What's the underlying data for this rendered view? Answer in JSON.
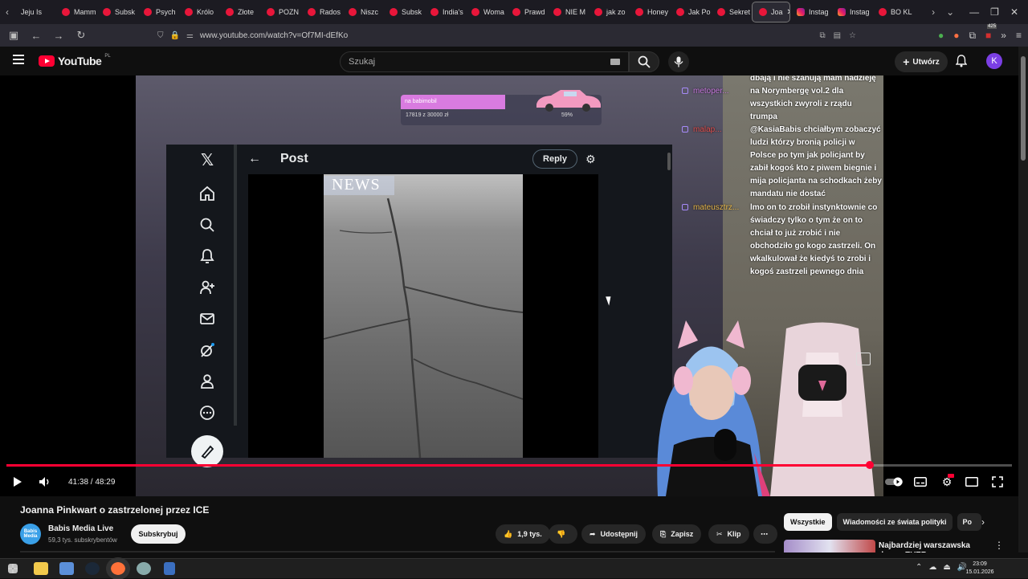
{
  "browser": {
    "tabs": [
      {
        "label": "Jeju Is",
        "icon": "tab-favicon"
      },
      {
        "label": "Mamm",
        "icon": "youtube-icon"
      },
      {
        "label": "Subsk",
        "icon": "youtube-icon"
      },
      {
        "label": "Psych",
        "icon": "youtube-icon"
      },
      {
        "label": "Królo",
        "icon": "youtube-icon"
      },
      {
        "label": "Złote",
        "icon": "youtube-icon"
      },
      {
        "label": "POZN",
        "icon": "youtube-icon"
      },
      {
        "label": "Rados",
        "icon": "youtube-icon"
      },
      {
        "label": "Niszc",
        "icon": "youtube-icon"
      },
      {
        "label": "Subsk",
        "icon": "youtube-icon"
      },
      {
        "label": "India's",
        "icon": "youtube-icon"
      },
      {
        "label": "Woma",
        "icon": "youtube-icon"
      },
      {
        "label": "Prawd",
        "icon": "youtube-icon"
      },
      {
        "label": "NIE M",
        "icon": "youtube-icon"
      },
      {
        "label": "jak zo",
        "icon": "youtube-icon"
      },
      {
        "label": "Honey",
        "icon": "youtube-icon"
      },
      {
        "label": "Jak Po",
        "icon": "youtube-icon"
      },
      {
        "label": "Sekret",
        "icon": "youtube-icon"
      },
      {
        "label": "Joa",
        "icon": "youtube-icon",
        "active": true
      },
      {
        "label": "Instag",
        "icon": "instagram-icon"
      },
      {
        "label": "Instag",
        "icon": "instagram-icon"
      },
      {
        "label": "BO KL",
        "icon": "youtube-icon"
      }
    ],
    "url": "www.youtube.com/watch?v=Of7MI-dEfKo",
    "badge_count": "425"
  },
  "youtube": {
    "logo_text": "YouTube",
    "region": "PL",
    "search_placeholder": "Szukaj",
    "create_label": "Utwórz",
    "avatar_letter": "K"
  },
  "video": {
    "donation": {
      "label": "na babimobil",
      "amount": "17819 z 30000 zł",
      "percent": "59%"
    },
    "x_post": {
      "title": "Post",
      "reply_label": "Reply",
      "news_label": "NEWS"
    },
    "chat": [
      {
        "user": "",
        "text": "dbają i nie szanują mam nadzieję na Norymbergę vol.2 dla wszystkich zwyroli z rządu trumpa"
      },
      {
        "user": "metoper...",
        "text": ""
      },
      {
        "user": "malap...",
        "text": "@KasiaBabis chciałbym zobaczyć ludzi którzy bronią policji w Polsce po tym jak policjant by zabił kogoś kto z piwem biegnie i mija policjanta na schodkach żeby mandatu nie dostać"
      },
      {
        "user": "mateusztrz...",
        "text": "lmo on to zrobił instynktownie co świadczy tylko o tym że on to chciał to już zrobić i nie obchodziło go kogo zastrzeli. On wkalkulował że kiedyś to zrobi i kogoś zastrzeli pewnego dnia"
      }
    ],
    "time_current": "41:38",
    "time_total": "48:29",
    "progress_fraction": 0.8587
  },
  "meta": {
    "title": "Joanna Pinkwart o zastrzelonej przez ICE",
    "channel_name": "Babis Media Live",
    "channel_avatar_text": "Babis Media",
    "subscribers": "59,3 tys. subskrybentów",
    "subscribe_label": "Subskrybuj",
    "likes": "1,9 tys.",
    "share_label": "Udostępnij",
    "save_label": "Zapisz",
    "clip_label": "Klip"
  },
  "sidebar": {
    "chips": [
      "Wszystkie",
      "Wiadomości ze świata polityki",
      "Po"
    ],
    "rec_title": "Najbardziej warszawska drama EVER"
  },
  "taskbar": {
    "time": "23:09",
    "date": "15.01.2026"
  },
  "colors": {
    "accent": "#ff0033",
    "avatar": "#7b3fe4",
    "chip_active": "#f1f1f1"
  }
}
